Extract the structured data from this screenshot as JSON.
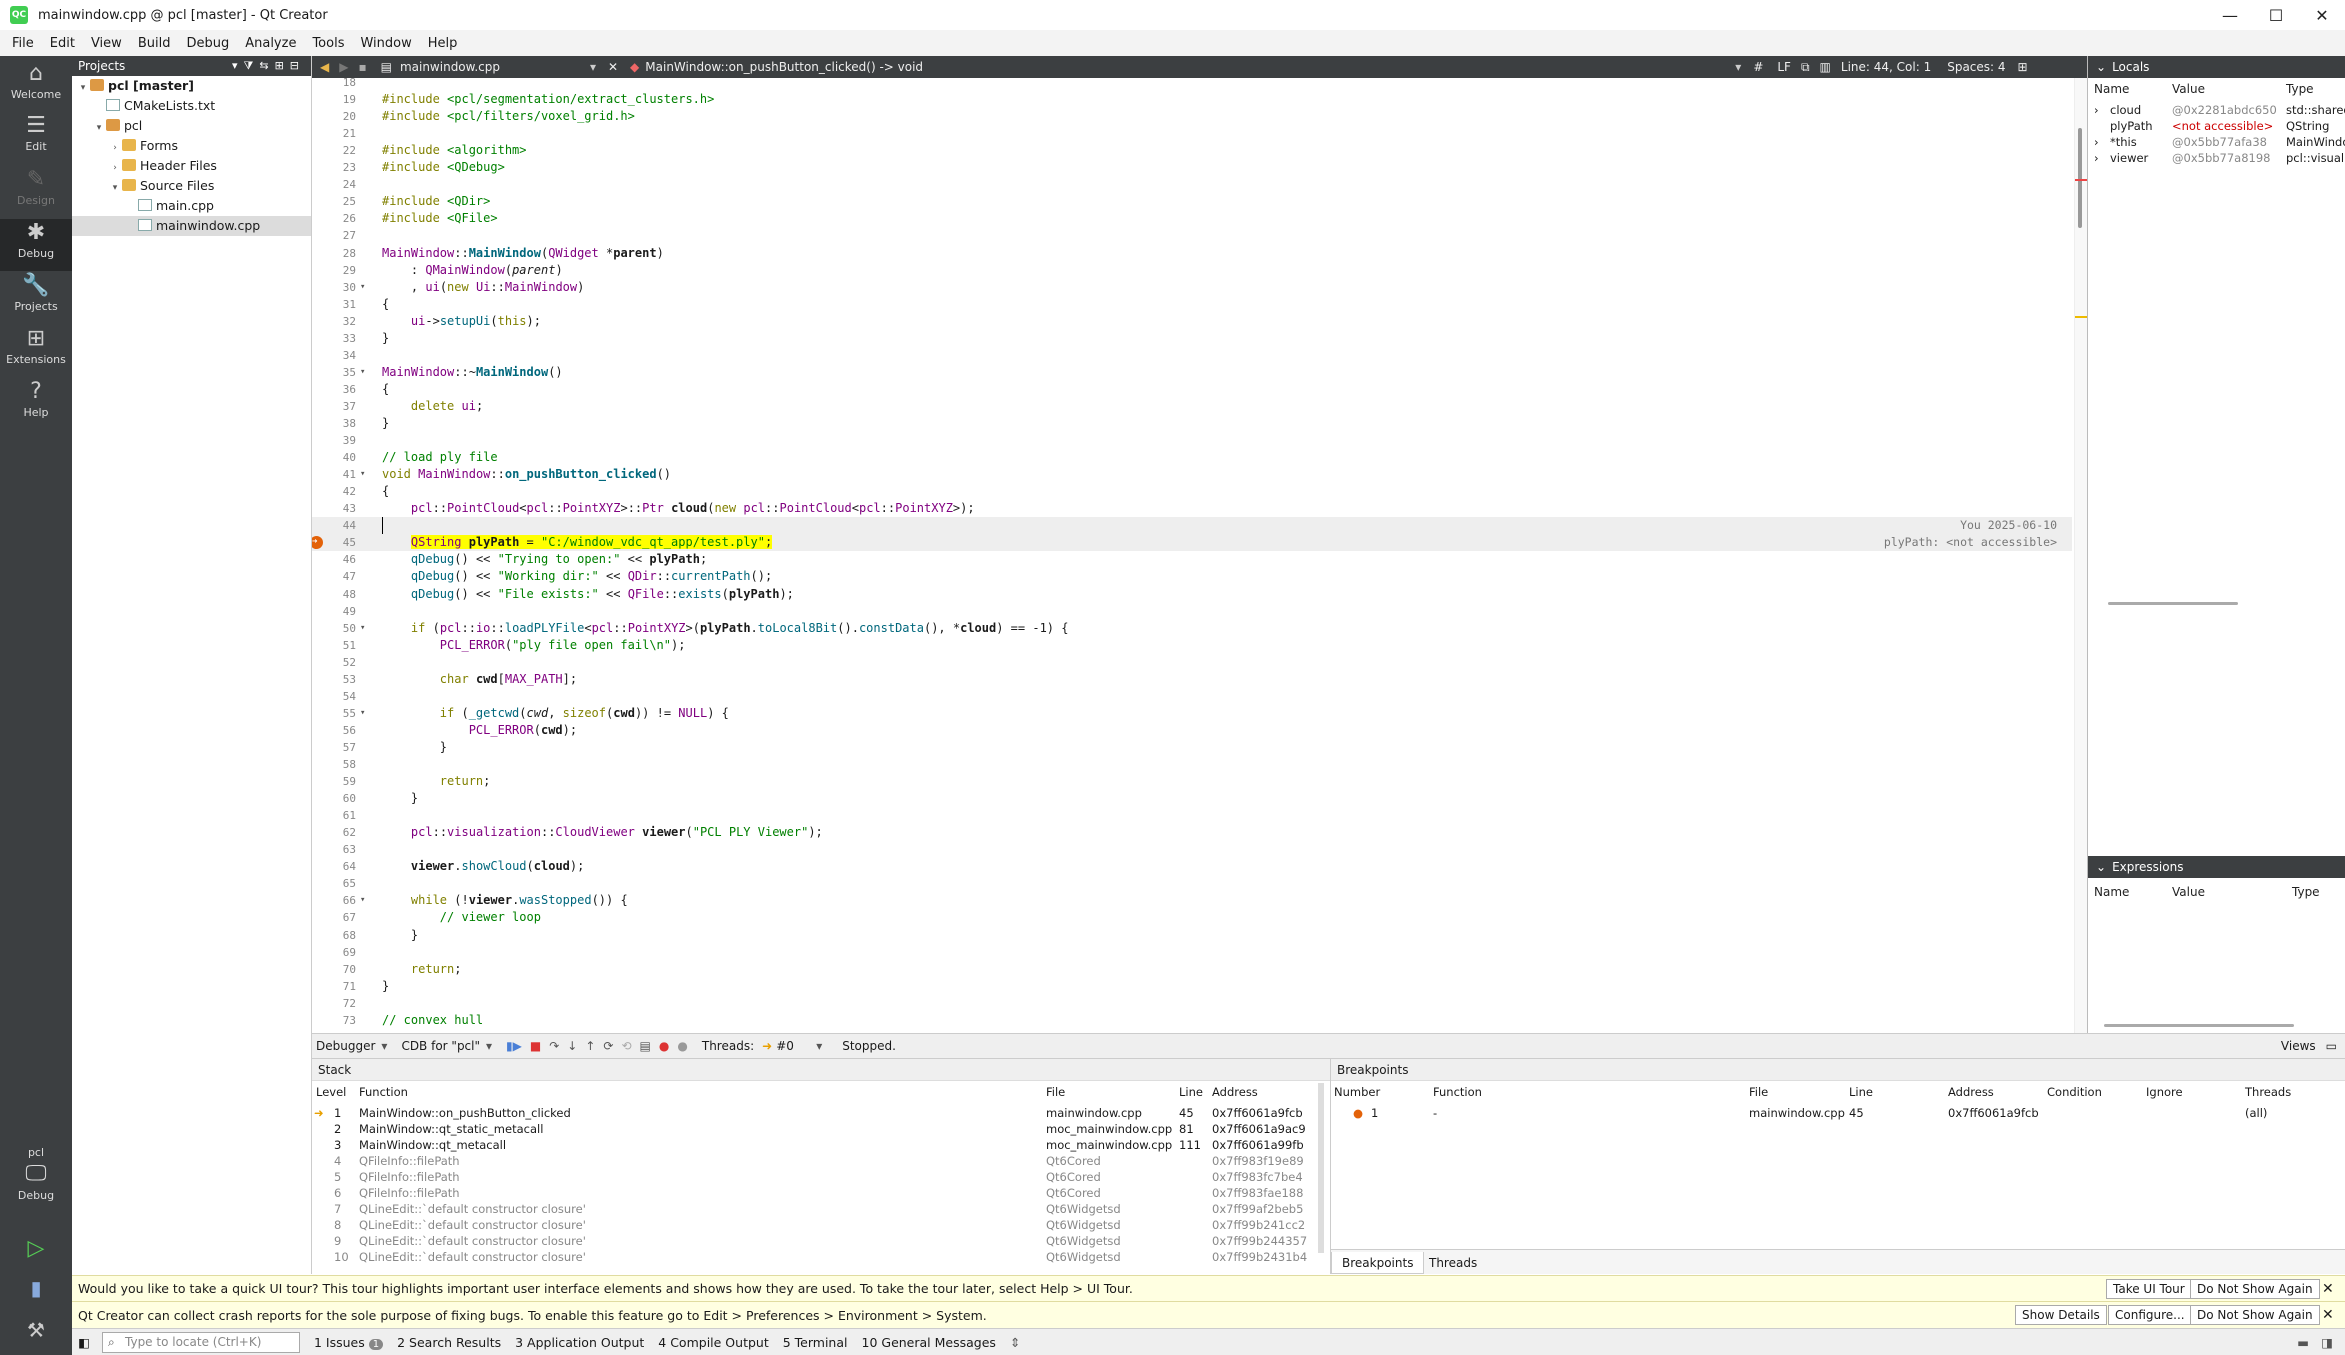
{
  "window": {
    "title": "mainwindow.cpp @ pcl [master] - Qt Creator",
    "app_icon": "QC"
  },
  "menu": [
    "File",
    "Edit",
    "View",
    "Build",
    "Debug",
    "Analyze",
    "Tools",
    "Window",
    "Help"
  ],
  "modes": [
    {
      "label": "Welcome",
      "icon": "⌂"
    },
    {
      "label": "Edit",
      "icon": "☰"
    },
    {
      "label": "Design",
      "icon": "✎"
    },
    {
      "label": "Debug",
      "icon": "✱"
    },
    {
      "label": "Projects",
      "icon": "🔧"
    },
    {
      "label": "Extensions",
      "icon": "⊞"
    },
    {
      "label": "Help",
      "icon": "?"
    }
  ],
  "kit": {
    "label": "pcl",
    "mode": "Debug"
  },
  "projects": {
    "header": "Projects",
    "tree": [
      {
        "label": "pcl [master]",
        "level": 0,
        "icon": "proj",
        "fold": "▾",
        "bold": true
      },
      {
        "label": "CMakeLists.txt",
        "level": 1,
        "icon": "file",
        "fold": ""
      },
      {
        "label": "pcl",
        "level": 1,
        "icon": "proj",
        "fold": "▾"
      },
      {
        "label": "Forms",
        "level": 2,
        "icon": "folder",
        "fold": "›"
      },
      {
        "label": "Header Files",
        "level": 2,
        "icon": "folder",
        "fold": "›"
      },
      {
        "label": "Source Files",
        "level": 2,
        "icon": "folder",
        "fold": "▾"
      },
      {
        "label": "main.cpp",
        "level": 3,
        "icon": "file",
        "fold": ""
      },
      {
        "label": "mainwindow.cpp",
        "level": 3,
        "icon": "file",
        "fold": "",
        "selected": true
      }
    ]
  },
  "editor": {
    "file": "mainwindow.cpp",
    "function": "MainWindow::on_pushButton_clicked() -> void",
    "hash": "#",
    "line_ending": "LF",
    "position": "Line: 44, Col: 1",
    "spaces": "Spaces: 4",
    "blame": "You 2025-06-10",
    "tooltip": "plyPath: <not accessible>"
  },
  "code_lines": [
    {
      "n": "18",
      "html": ""
    },
    {
      "n": "19",
      "html": "<span class='kw'>#include</span> <span class='st'>&lt;pcl/segmentation/extract_clusters.h&gt;</span>"
    },
    {
      "n": "20",
      "html": "<span class='kw'>#include</span> <span class='st'>&lt;pcl/filters/voxel_grid.h&gt;</span>"
    },
    {
      "n": "21",
      "html": ""
    },
    {
      "n": "22",
      "html": "<span class='kw'>#include</span> <span class='st'>&lt;algorithm&gt;</span>"
    },
    {
      "n": "23",
      "html": "<span class='kw'>#include</span> <span class='st'>&lt;QDebug&gt;</span>"
    },
    {
      "n": "24",
      "html": ""
    },
    {
      "n": "25",
      "html": "<span class='kw'>#include</span> <span class='st'>&lt;QDir&gt;</span>"
    },
    {
      "n": "26",
      "html": "<span class='kw'>#include</span> <span class='st'>&lt;QFile&gt;</span>"
    },
    {
      "n": "27",
      "html": ""
    },
    {
      "n": "28",
      "html": "<span class='ty'>MainWindow</span>::<span class='fn bold'>MainWindow</span>(<span class='ty'>QWidget</span> *<span class='bold'>parent</span>)"
    },
    {
      "n": "29",
      "html": "    : <span class='ty'>QMainWindow</span>(<i>parent</i>)"
    },
    {
      "n": "30",
      "html": "    , <span class='ty'>ui</span>(<span class='kw'>new</span> <span class='ty'>Ui</span>::<span class='ty'>MainWindow</span>)",
      "fold": "▾"
    },
    {
      "n": "31",
      "html": "{"
    },
    {
      "n": "32",
      "html": "    <span class='ty'>ui</span>-&gt;<span class='fn'>setupUi</span>(<span class='kw'>this</span>);"
    },
    {
      "n": "33",
      "html": "}"
    },
    {
      "n": "34",
      "html": ""
    },
    {
      "n": "35",
      "html": "<span class='ty'>MainWindow</span>::~<span class='fn bold'>MainWindow</span>()",
      "fold": "▾"
    },
    {
      "n": "36",
      "html": "{"
    },
    {
      "n": "37",
      "html": "    <span class='kw'>delete</span> <span class='ty'>ui</span>;"
    },
    {
      "n": "38",
      "html": "}"
    },
    {
      "n": "39",
      "html": ""
    },
    {
      "n": "40",
      "html": "<span class='cm'>// load ply file</span>"
    },
    {
      "n": "41",
      "html": "<span class='kw'>void</span> <span class='ty'>MainWindow</span>::<span class='fn bold'>on_pushButton_clicked</span>()",
      "fold": "▾"
    },
    {
      "n": "42",
      "html": "{"
    },
    {
      "n": "43",
      "html": "    <span class='ty'>pcl</span>::<span class='ty'>PointCloud</span>&lt;<span class='ty'>pcl</span>::<span class='ty'>PointXYZ</span>&gt;::<span class='ty'>Ptr</span> <span class='bold'>cloud</span>(<span class='kw'>new</span> <span class='ty'>pcl</span>::<span class='ty'>PointCloud</span>&lt;<span class='ty'>pcl</span>::<span class='ty'>PointXYZ</span>&gt;);"
    },
    {
      "n": "44",
      "html": "",
      "current": true
    },
    {
      "n": "45",
      "html": "    <span class='hl'><span class='ty'>QString</span> <span class='bold'>plyPath</span> = <span class='st'>\"C:/window_vdc_qt_app/test.ply\"</span>;</span>",
      "bp": true
    },
    {
      "n": "46",
      "html": "    <span class='fn'>qDebug</span>() &lt;&lt; <span class='st'>\"Trying to open:\"</span> &lt;&lt; <span class='bold'>plyPath</span>;"
    },
    {
      "n": "47",
      "html": "    <span class='fn'>qDebug</span>() &lt;&lt; <span class='st'>\"Working dir:\"</span> &lt;&lt; <span class='ty'>QDir</span>::<span class='fn'>currentPath</span>();"
    },
    {
      "n": "48",
      "html": "    <span class='fn'>qDebug</span>() &lt;&lt; <span class='st'>\"File exists:\"</span> &lt;&lt; <span class='ty'>QFile</span>::<span class='fn'>exists</span>(<span class='bold'>plyPath</span>);"
    },
    {
      "n": "49",
      "html": ""
    },
    {
      "n": "50",
      "html": "    <span class='kw'>if</span> (<span class='ty'>pcl</span>::<span class='ty'>io</span>::<span class='fn'>loadPLYFile</span>&lt;<span class='ty'>pcl</span>::<span class='ty'>PointXYZ</span>&gt;(<span class='bold'>plyPath</span>.<span class='fn'>toLocal8Bit</span>().<span class='fn'>constData</span>(), *<span class='bold'>cloud</span>) == -1) {",
      "fold": "▾"
    },
    {
      "n": "51",
      "html": "        <span class='ty'>PCL_ERROR</span>(<span class='st'>\"ply file open fail\\n\"</span>);"
    },
    {
      "n": "52",
      "html": ""
    },
    {
      "n": "53",
      "html": "        <span class='kw'>char</span> <span class='bold'>cwd</span>[<span class='ty'>MAX_PATH</span>];"
    },
    {
      "n": "54",
      "html": ""
    },
    {
      "n": "55",
      "html": "        <span class='kw'>if</span> (<span class='fn'>_getcwd</span>(<i>cwd</i>, <span class='kw'>sizeof</span>(<span class='bold'>cwd</span>)) != <span class='ty'>NULL</span>) {",
      "fold": "▾"
    },
    {
      "n": "56",
      "html": "            <span class='ty'>PCL_ERROR</span>(<span class='bold'>cwd</span>);"
    },
    {
      "n": "57",
      "html": "        }"
    },
    {
      "n": "58",
      "html": ""
    },
    {
      "n": "59",
      "html": "        <span class='kw'>return</span>;"
    },
    {
      "n": "60",
      "html": "    }"
    },
    {
      "n": "61",
      "html": ""
    },
    {
      "n": "62",
      "html": "    <span class='ty'>pcl</span>::<span class='ty'>visualization</span>::<span class='ty'>CloudViewer</span> <span class='bold'>viewer</span>(<span class='st'>\"PCL PLY Viewer\"</span>);"
    },
    {
      "n": "63",
      "html": ""
    },
    {
      "n": "64",
      "html": "    <span class='bold'>viewer</span>.<span class='fn'>showCloud</span>(<span class='bold'>cloud</span>);"
    },
    {
      "n": "65",
      "html": ""
    },
    {
      "n": "66",
      "html": "    <span class='kw'>while</span> (!<span class='bold'>viewer</span>.<span class='fn'>wasStopped</span>()) {",
      "fold": "▾"
    },
    {
      "n": "67",
      "html": "        <span class='cm'>// viewer loop</span>"
    },
    {
      "n": "68",
      "html": "    }"
    },
    {
      "n": "69",
      "html": ""
    },
    {
      "n": "70",
      "html": "    <span class='kw'>return</span>;"
    },
    {
      "n": "71",
      "html": "}"
    },
    {
      "n": "72",
      "html": ""
    },
    {
      "n": "73",
      "html": "<span class='cm'>// convex hull</span>"
    }
  ],
  "locals": {
    "header": "Locals",
    "columns": [
      "Name",
      "Value",
      "Type"
    ],
    "rows": [
      {
        "exp": "›",
        "name": "cloud",
        "value": "@0x2281abdc650",
        "type": "std::shared",
        "vcolor": "#888"
      },
      {
        "exp": "",
        "name": "plyPath",
        "value": "<not accessible>",
        "type": "QString",
        "vcolor": "#c00"
      },
      {
        "exp": "›",
        "name": "*this",
        "value": "@0x5bb77afa38",
        "type": "MainWindo",
        "vcolor": "#888"
      },
      {
        "exp": "›",
        "name": "viewer",
        "value": "@0x5bb77a8198",
        "type": "pcl::visuali",
        "vcolor": "#888"
      }
    ]
  },
  "expressions": {
    "header": "Expressions",
    "columns": [
      "Name",
      "Value",
      "Type"
    ]
  },
  "debugger": {
    "label": "Debugger",
    "engine": "CDB for \"pcl\"",
    "threads_label": "Threads:",
    "thread": "#0",
    "status": "Stopped.",
    "views": "Views"
  },
  "stack": {
    "header": "Stack",
    "columns": [
      "Level",
      "Function",
      "File",
      "Line",
      "Address"
    ],
    "rows": [
      {
        "level": "1",
        "fn": "MainWindow::on_pushButton_clicked",
        "file": "mainwindow.cpp",
        "line": "45",
        "addr": "0x7ff6061a9fcb",
        "active": true
      },
      {
        "level": "2",
        "fn": "MainWindow::qt_static_metacall",
        "file": "moc_mainwindow.cpp",
        "line": "81",
        "addr": "0x7ff6061a9ac9",
        "active": true
      },
      {
        "level": "3",
        "fn": "MainWindow::qt_metacall",
        "file": "moc_mainwindow.cpp",
        "line": "111",
        "addr": "0x7ff6061a99fb",
        "active": true
      },
      {
        "level": "4",
        "fn": "QFileInfo::filePath",
        "file": "Qt6Cored",
        "line": "",
        "addr": "0x7ff983f19e89"
      },
      {
        "level": "5",
        "fn": "QFileInfo::filePath",
        "file": "Qt6Cored",
        "line": "",
        "addr": "0x7ff983fc7be4"
      },
      {
        "level": "6",
        "fn": "QFileInfo::filePath",
        "file": "Qt6Cored",
        "line": "",
        "addr": "0x7ff983fae188"
      },
      {
        "level": "7",
        "fn": "QLineEdit::`default constructor closure'",
        "file": "Qt6Widgetsd",
        "line": "",
        "addr": "0x7ff99af2beb5"
      },
      {
        "level": "8",
        "fn": "QLineEdit::`default constructor closure'",
        "file": "Qt6Widgetsd",
        "line": "",
        "addr": "0x7ff99b241cc2"
      },
      {
        "level": "9",
        "fn": "QLineEdit::`default constructor closure'",
        "file": "Qt6Widgetsd",
        "line": "",
        "addr": "0x7ff99b244357"
      },
      {
        "level": "10",
        "fn": "QLineEdit::`default constructor closure'",
        "file": "Qt6Widgetsd",
        "line": "",
        "addr": "0x7ff99b2431b4"
      }
    ]
  },
  "breakpoints": {
    "header": "Breakpoints",
    "columns": [
      "Number",
      "Function",
      "File",
      "Line",
      "Address",
      "Condition",
      "Ignore",
      "Threads"
    ],
    "rows": [
      {
        "number": "1",
        "fn": "-",
        "file": "mainwindow.cpp",
        "line": "45",
        "addr": "0x7ff6061a9fcb",
        "threads": "(all)"
      }
    ],
    "tabs": [
      "Breakpoints",
      "Threads"
    ]
  },
  "info_tour": {
    "text": "Would you like to take a quick UI tour? This tour highlights important user interface elements and shows how they are used. To take the tour later, select Help > UI Tour.",
    "btn1": "Take UI Tour",
    "btn2": "Do Not Show Again"
  },
  "info_crash": {
    "text": "Qt Creator can collect crash reports for the sole purpose of fixing bugs. To enable this feature go to Edit > Preferences > Environment > System.",
    "btn1": "Show Details",
    "btn2": "Configure...",
    "btn3": "Do Not Show Again"
  },
  "status": {
    "locate_placeholder": "Type to locate (Ctrl+K)",
    "panes": [
      "1  Issues",
      "2  Search Results",
      "3  Application Output",
      "4  Compile Output",
      "5  Terminal",
      "10  General Messages"
    ],
    "issues_count": "1"
  },
  "colors": {
    "dark_panel": "#3c3f41",
    "highlight": "#ffff00",
    "info_bg": "#ffffe1",
    "breakpoint": "#e36209"
  }
}
